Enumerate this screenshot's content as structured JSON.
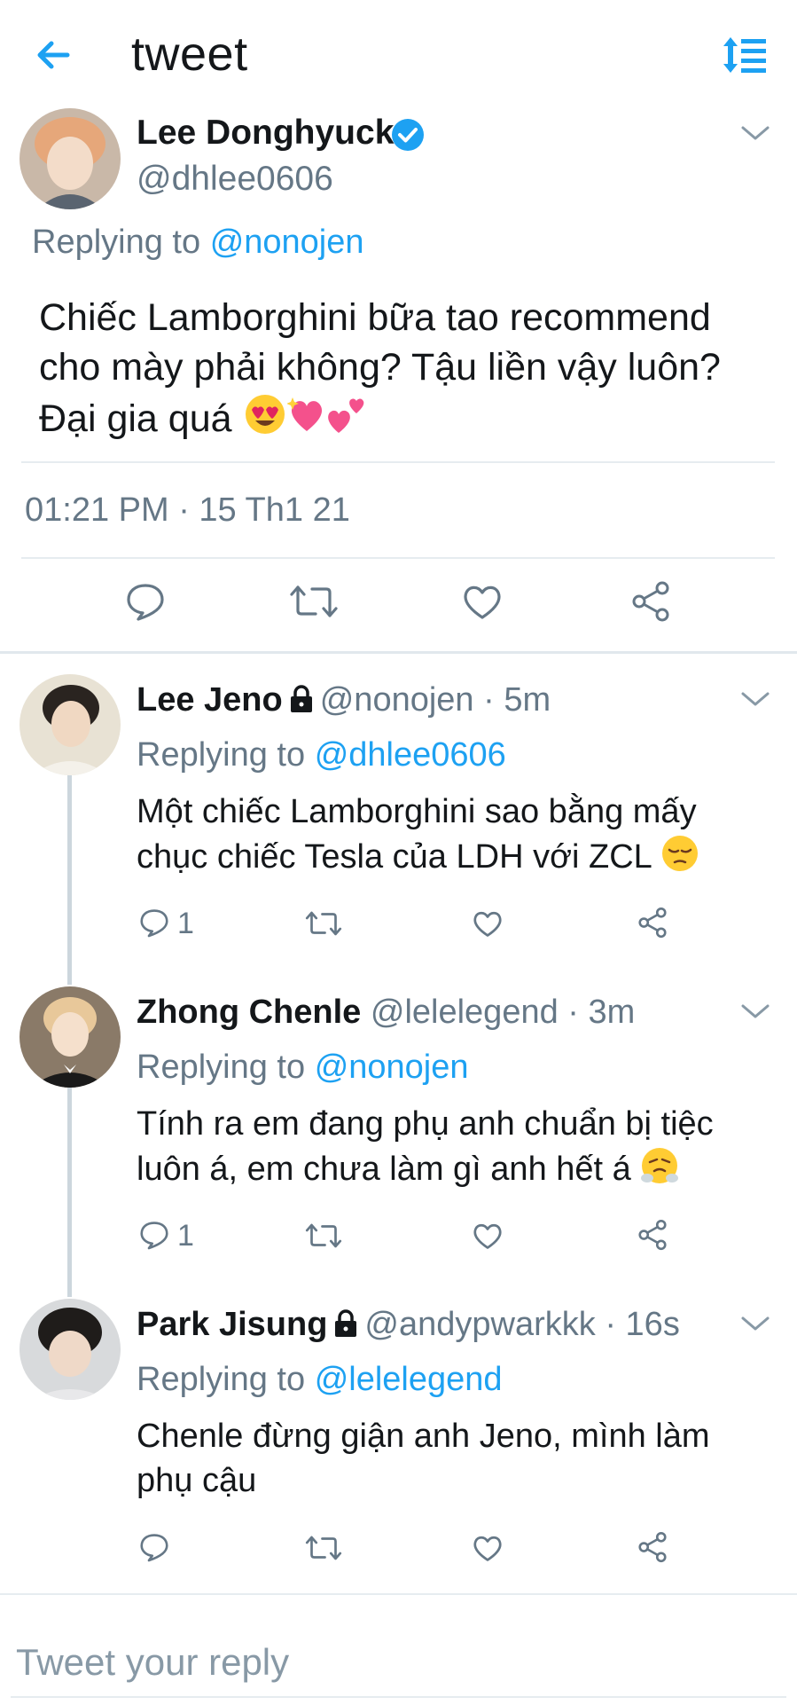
{
  "header": {
    "title": "tweet",
    "back_icon": "arrow-left-icon",
    "sort_icon": "sort-lines-icon"
  },
  "main_tweet": {
    "name": "Lee Donghyuck",
    "verified": true,
    "handle": "@dhlee0606",
    "replying_prefix": "Replying to",
    "replying_handle": "@nonojen",
    "text_line1": "Chiếc Lamborghini bữa tao recommend",
    "text_line2": "cho mày phải không? Tậu liền vậy luôn?",
    "text_line3": "Đại gia quá",
    "timestamp": "01:21 PM · 15 Th1 21"
  },
  "replies": [
    {
      "name": "Lee Jeno",
      "locked": true,
      "handle": "@nonojen",
      "time": "5m",
      "replying_prefix": "Replying to",
      "replying_handle": "@dhlee0606",
      "text_line1": "Một chiếc Lamborghini sao bằng mấy",
      "text_line2": "chục chiếc Tesla của LDH với ZCL",
      "reply_count": "1"
    },
    {
      "name": "Zhong Chenle",
      "locked": false,
      "handle": "@lelelegend",
      "time": "3m",
      "replying_prefix": "Replying to",
      "replying_handle": "@nonojen",
      "text_line1": "Tính ra em đang phụ anh chuẩn bị tiệc",
      "text_line2": "luôn á, em chưa làm gì anh hết á",
      "reply_count": "1"
    },
    {
      "name": "Park Jisung",
      "locked": true,
      "handle": "@andypwarkkk",
      "time": "16s",
      "replying_prefix": "Replying to",
      "replying_handle": "@lelelegend",
      "text_line1": "Chenle đừng giận anh Jeno, mình làm",
      "text_line2": "phụ cậu",
      "reply_count": ""
    }
  ],
  "composer": {
    "placeholder": "Tweet your reply"
  },
  "colors": {
    "accent": "#1da1f2",
    "secondary_text": "#657786",
    "divider": "#e6ecf0"
  }
}
